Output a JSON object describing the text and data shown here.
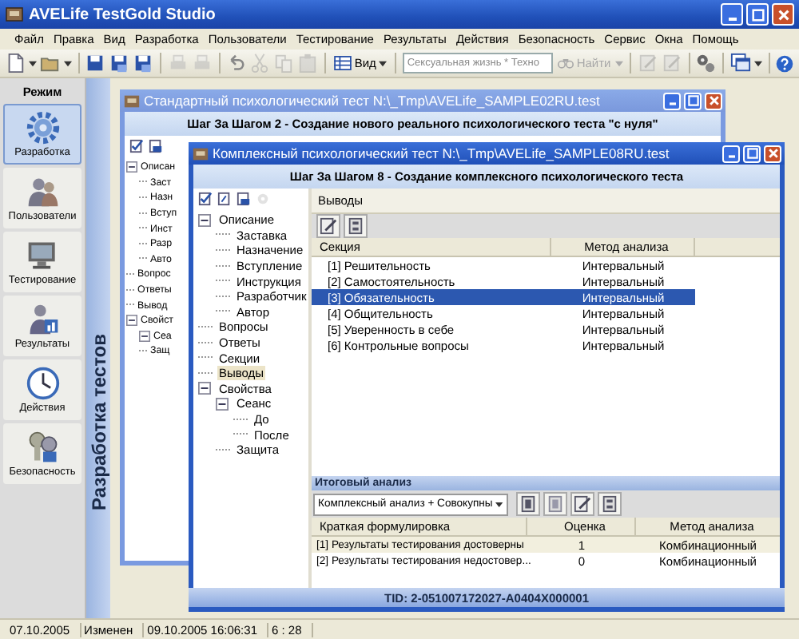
{
  "window": {
    "title": "AVELife TestGold Studio"
  },
  "menu": [
    "Файл",
    "Правка",
    "Вид",
    "Разработка",
    "Пользователи",
    "Тестирование",
    "Результаты",
    "Действия",
    "Безопасность",
    "Сервис",
    "Окна",
    "Помощь"
  ],
  "toolbar": {
    "view_button": "Вид",
    "search": {
      "value": "Сексуальная жизнь * Техно"
    },
    "find_button": {
      "label": "Найти",
      "disabled": true
    }
  },
  "sidebar": {
    "header": "Режим",
    "items": [
      {
        "label": "Разработка",
        "selected": true
      },
      {
        "label": "Пользователи",
        "selected": false
      },
      {
        "label": "Тестирование",
        "selected": false
      },
      {
        "label": "Результаты",
        "selected": false
      },
      {
        "label": "Действия",
        "selected": false
      },
      {
        "label": "Безопасность",
        "selected": false
      }
    ]
  },
  "section_title": "Разработка тестов",
  "back_document": {
    "title": "Стандартный психологический тест N:\\_Tmp\\AVELife_SAMPLE02RU.test",
    "step_header": "Шаг За Шагом 2 - Создание нового реального психологического теста \"с нуля\"",
    "tree": [
      {
        "label": "Описан",
        "expanded": true,
        "selected": false,
        "children": [
          {
            "label": "Заст",
            "selected": false
          },
          {
            "label": "Назн",
            "selected": false
          },
          {
            "label": "Вступ",
            "selected": false
          },
          {
            "label": "Инст",
            "selected": false
          },
          {
            "label": "Разр",
            "selected": false
          },
          {
            "label": "Авто",
            "selected": false
          }
        ]
      },
      {
        "label": "Вопрос",
        "selected": false
      },
      {
        "label": "Ответы",
        "selected": false
      },
      {
        "label": "Вывод",
        "selected": false
      },
      {
        "label": "Свойст",
        "expanded": true,
        "selected": false,
        "children": [
          {
            "label": "Сеа",
            "expanded": true,
            "selected": false
          },
          {
            "label": "Защ",
            "selected": false
          }
        ]
      }
    ]
  },
  "front_document": {
    "title": "Комплексный психологический тест N:\\_Tmp\\AVELife_SAMPLE08RU.test",
    "step_header": "Шаг За Шагом 8 - Создание комплексного психологического теста",
    "tree": [
      {
        "label": "Описание",
        "expanded": true,
        "selected": false,
        "children": [
          {
            "label": "Заставка",
            "selected": false
          },
          {
            "label": "Назначение",
            "selected": false
          },
          {
            "label": "Вступление",
            "selected": false
          },
          {
            "label": "Инструкция",
            "selected": false
          },
          {
            "label": "Разработчик",
            "selected": false
          },
          {
            "label": "Автор",
            "selected": false
          }
        ]
      },
      {
        "label": "Вопросы",
        "selected": false
      },
      {
        "label": "Ответы",
        "selected": false
      },
      {
        "label": "Секции",
        "selected": false
      },
      {
        "label": "Выводы",
        "selected": true
      },
      {
        "label": "Свойства",
        "expanded": true,
        "selected": false,
        "children": [
          {
            "label": "Сеанс",
            "expanded": true,
            "selected": false,
            "children": [
              {
                "label": "До",
                "selected": false
              },
              {
                "label": "После",
                "selected": false
              }
            ]
          },
          {
            "label": "Защита",
            "selected": false
          }
        ]
      }
    ],
    "panel_title": "Выводы",
    "sections_table": {
      "columns": [
        "Секция",
        "Метод анализа"
      ],
      "rows": [
        {
          "cells": [
            "[1] Решительность",
            "Интервальный"
          ],
          "selected": false
        },
        {
          "cells": [
            "[2] Самостоятельность",
            "Интервальный"
          ],
          "selected": false
        },
        {
          "cells": [
            "[3] Обязательность",
            "Интервальный"
          ],
          "selected": true
        },
        {
          "cells": [
            "[4] Общительность",
            "Интервальный"
          ],
          "selected": false
        },
        {
          "cells": [
            "[5] Уверенность в себе",
            "Интервальный"
          ],
          "selected": false
        },
        {
          "cells": [
            "[6] Контрольные вопросы",
            "Интервальный"
          ],
          "selected": false
        }
      ]
    },
    "summary": {
      "title": "Итоговый анализ",
      "dropdown": "Комплексный анализ + Совокупны",
      "columns": [
        "Краткая формулировка",
        "Оценка",
        "Метод анализа"
      ],
      "rows": [
        {
          "cells": [
            "[1] Результаты тестирования достоверны",
            "1",
            "Комбинационный"
          ],
          "selected": true
        },
        {
          "cells": [
            "[2] Результаты тестирования недостовер...",
            "0",
            "Комбинационный"
          ],
          "selected": false
        }
      ]
    },
    "footer": "TID: 2-051007172027-A0404X000001"
  },
  "status_bar": [
    "07.10.2005",
    "Изменен",
    "09.10.2005 16:06:31",
    "6 : 28"
  ]
}
